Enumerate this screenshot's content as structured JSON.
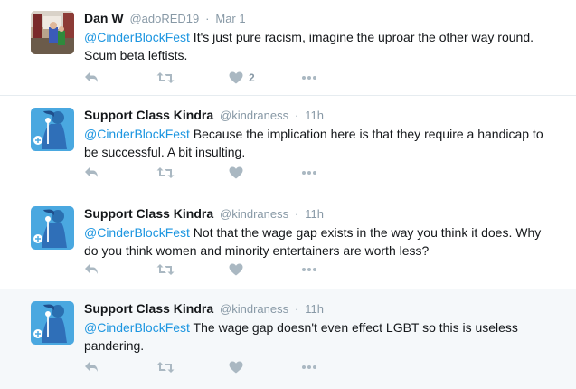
{
  "colors": {
    "link": "#1b95e0",
    "muted": "#8899a6",
    "icon": "#aab8c2",
    "highlight_bg": "#f5f8fa"
  },
  "tweets": [
    {
      "fullname": "Dan W",
      "screen_name": "@adoRED19",
      "dot": "·",
      "time": "Mar 1",
      "mention": "@CinderBlockFest",
      "text": " It's just pure racism, imagine the uproar the other way round. Scum beta leftists.",
      "like_count": "2",
      "avatar": "photo-avatar"
    },
    {
      "fullname": "Support Class Kindra",
      "screen_name": "@kindraness",
      "dot": "·",
      "time": "11h",
      "mention": "@CinderBlockFest",
      "text": " Because the implication here is that they require a handicap to be successful. A bit insulting.",
      "like_count": "",
      "avatar": "illustration-avatar"
    },
    {
      "fullname": "Support Class Kindra",
      "screen_name": "@kindraness",
      "dot": "·",
      "time": "11h",
      "mention": "@CinderBlockFest",
      "text": " Not that the wage gap exists in the way you think it does. Why do you think women and minority entertainers are worth less?",
      "like_count": "",
      "avatar": "illustration-avatar"
    },
    {
      "fullname": "Support Class Kindra",
      "screen_name": "@kindraness",
      "dot": "·",
      "time": "11h",
      "mention": "@CinderBlockFest",
      "text": " The wage gap doesn't even effect LGBT so this is useless pandering.",
      "like_count": "",
      "avatar": "illustration-avatar"
    }
  ],
  "icons": [
    "reply-icon",
    "retweet-icon",
    "like-icon",
    "more-icon"
  ]
}
